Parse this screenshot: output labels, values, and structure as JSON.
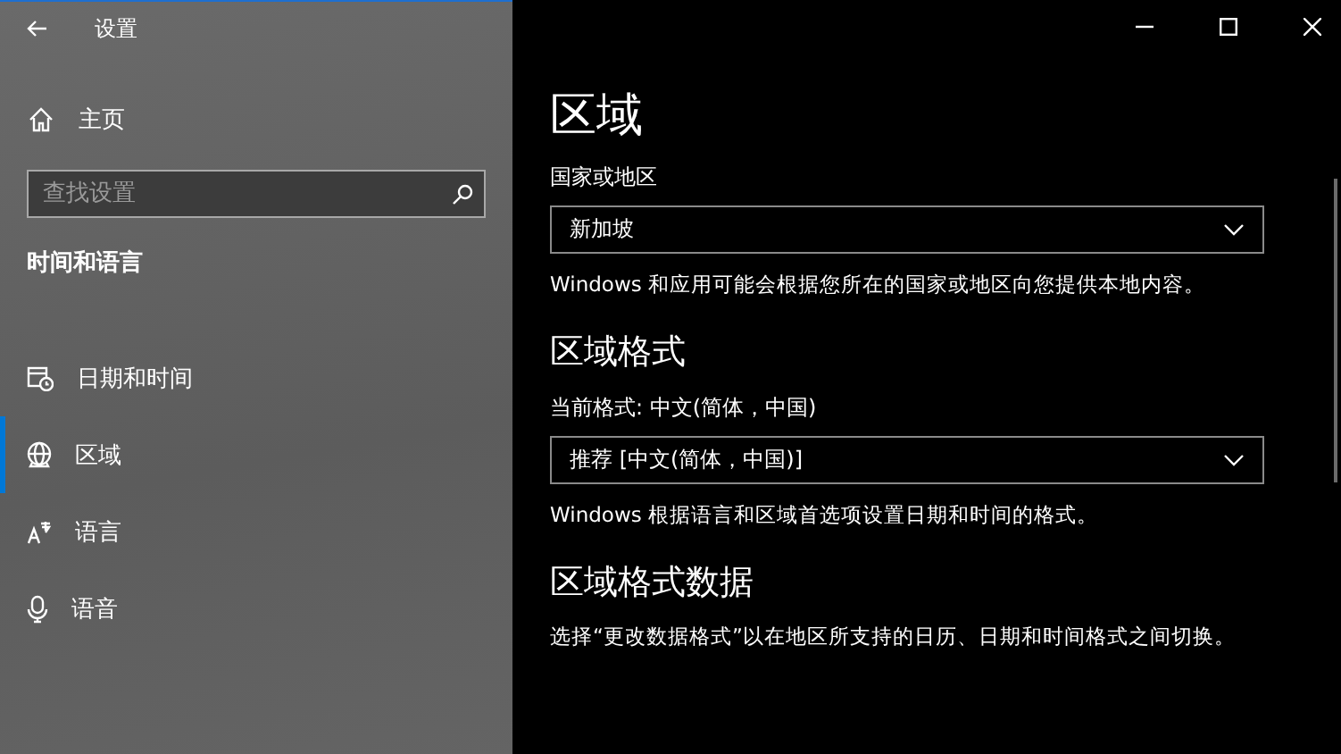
{
  "window": {
    "title": "设置"
  },
  "sidebar": {
    "home": "主页",
    "search": {
      "placeholder": "查找设置"
    },
    "section": "时间和语言",
    "items": [
      {
        "label": "日期和时间",
        "selected": false
      },
      {
        "label": "区域",
        "selected": true
      },
      {
        "label": "语言",
        "selected": false
      },
      {
        "label": "语音",
        "selected": false
      }
    ]
  },
  "content": {
    "title": "区域",
    "sections": [
      {
        "kind": "dropdown",
        "label": "国家或地区",
        "value": "新加坡",
        "description": "Windows 和应用可能会根据您所在的国家或地区向您提供本地内容。"
      },
      {
        "kind": "heading",
        "text": "区域格式"
      },
      {
        "kind": "dropdown",
        "label": "当前格式: 中文(简体，中国)",
        "value": "推荐 [中文(简体，中国)]",
        "description": "Windows 根据语言和区域首选项设置日期和时间的格式。"
      },
      {
        "kind": "heading",
        "text": "区域格式数据"
      },
      {
        "kind": "text",
        "text": "选择“更改数据格式”以在地区所支持的日历、日期和时间格式之间切换。"
      }
    ]
  }
}
